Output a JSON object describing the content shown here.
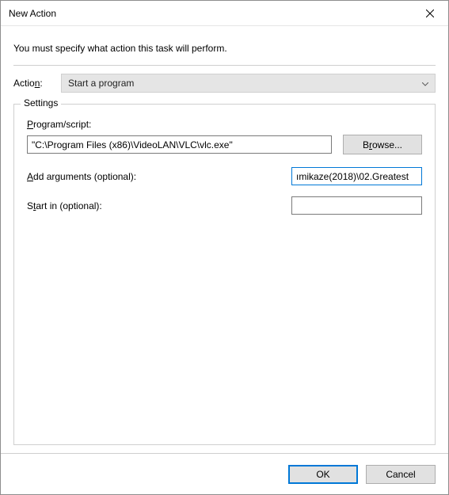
{
  "window": {
    "title": "New Action"
  },
  "instruction": "You must specify what action this task will perform.",
  "action": {
    "label_pre": "Actio",
    "label_u": "n",
    "label_post": ":",
    "selected": "Start a program"
  },
  "settings": {
    "group_label": "Settings",
    "program": {
      "label_u": "P",
      "label_post": "rogram/script:",
      "value": "\"C:\\Program Files (x86)\\VideoLAN\\VLC\\vlc.exe\"",
      "browse_pre": "B",
      "browse_u": "r",
      "browse_post": "owse..."
    },
    "arguments": {
      "label_u": "A",
      "label_post": "dd arguments (optional):",
      "value": "ımikaze(2018)\\02.Greatest"
    },
    "startin": {
      "label_pre": "S",
      "label_u": "t",
      "label_post": "art in (optional):",
      "value": ""
    }
  },
  "buttons": {
    "ok": "OK",
    "cancel": "Cancel"
  }
}
